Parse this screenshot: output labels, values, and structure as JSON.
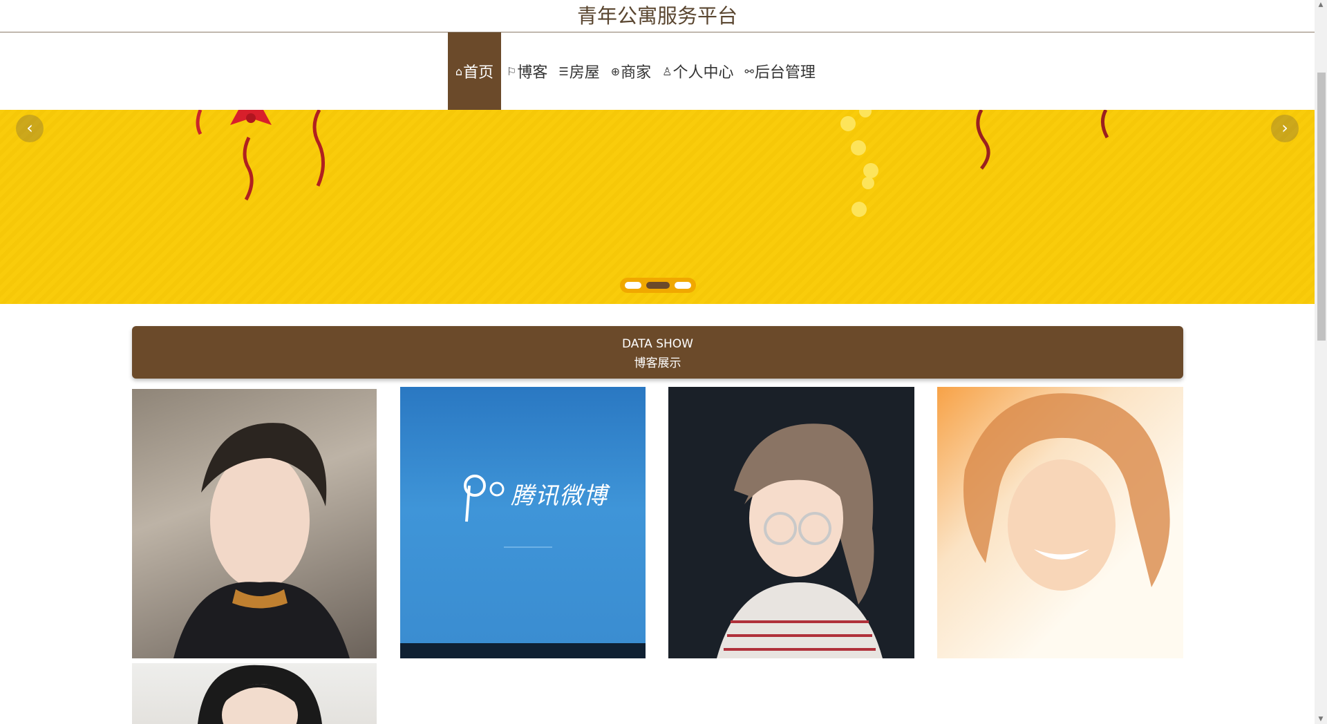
{
  "header": {
    "title": "青年公寓服务平台"
  },
  "nav": {
    "items": [
      {
        "icon": "home-icon",
        "glyph": "⌂",
        "label": "首页",
        "active": true
      },
      {
        "icon": "flag-icon",
        "glyph": "⚐",
        "label": "博客"
      },
      {
        "icon": "sliders-icon",
        "glyph": "☰",
        "label": "房屋"
      },
      {
        "icon": "globe-icon",
        "glyph": "⊕",
        "label": "商家"
      },
      {
        "icon": "user-icon",
        "glyph": "♙",
        "label": "个人中心"
      },
      {
        "icon": "link-icon",
        "glyph": "⚯",
        "label": "后台管理"
      }
    ]
  },
  "carousel": {
    "prev_glyph": "‹",
    "next_glyph": "›",
    "slide_count": 3,
    "active_index": 1,
    "background_color": "#f9cc0b"
  },
  "section": {
    "title_en": "DATA SHOW",
    "title_zh": "博客展示"
  },
  "blog_cards": [
    {
      "image": "portrait-photo"
    },
    {
      "image": "tencent-weibo-screen",
      "text": "腾讯微博"
    },
    {
      "image": "cartoon-girl-glasses"
    },
    {
      "image": "smiling-girl-photo"
    },
    {
      "image": "portrait-photo-2"
    }
  ],
  "colors": {
    "brand_brown": "#6b4a2a",
    "banner_yellow": "#f9cc0b",
    "title_text": "#5a4630"
  }
}
